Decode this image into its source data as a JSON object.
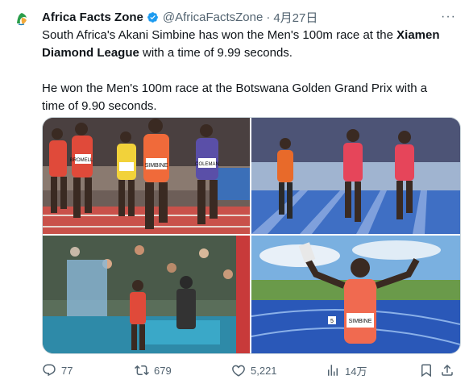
{
  "tweet": {
    "author_name": "Africa Facts Zone",
    "handle": "@AfricaFactsZone",
    "separator": "·",
    "date": "4月27日",
    "more": "···",
    "text": {
      "p1_a": "South Africa's Akani Simbine has won the Men's 100m race at the ",
      "p1_b": "Xiamen Diamond League",
      "p1_c": " with a time of 9.99 seconds.",
      "p2": "He won the Men's 100m race at the Botswana Golden Grand Prix with a time of 9.90 seconds."
    },
    "bibs": {
      "photo1": [
        "SIMBINE",
        "BROMELL",
        "COLEMAN"
      ],
      "photo4": "SIMBINE",
      "photo4_lane": "5"
    },
    "actions": {
      "replies": "77",
      "retweets": "679",
      "likes": "5,221",
      "views": "14万"
    }
  },
  "colors": {
    "text": "#0f1419",
    "secondary": "#536471",
    "verified": "#1d9bf0",
    "track_red": "#c94a3a",
    "track_blue": "#2457b8"
  }
}
